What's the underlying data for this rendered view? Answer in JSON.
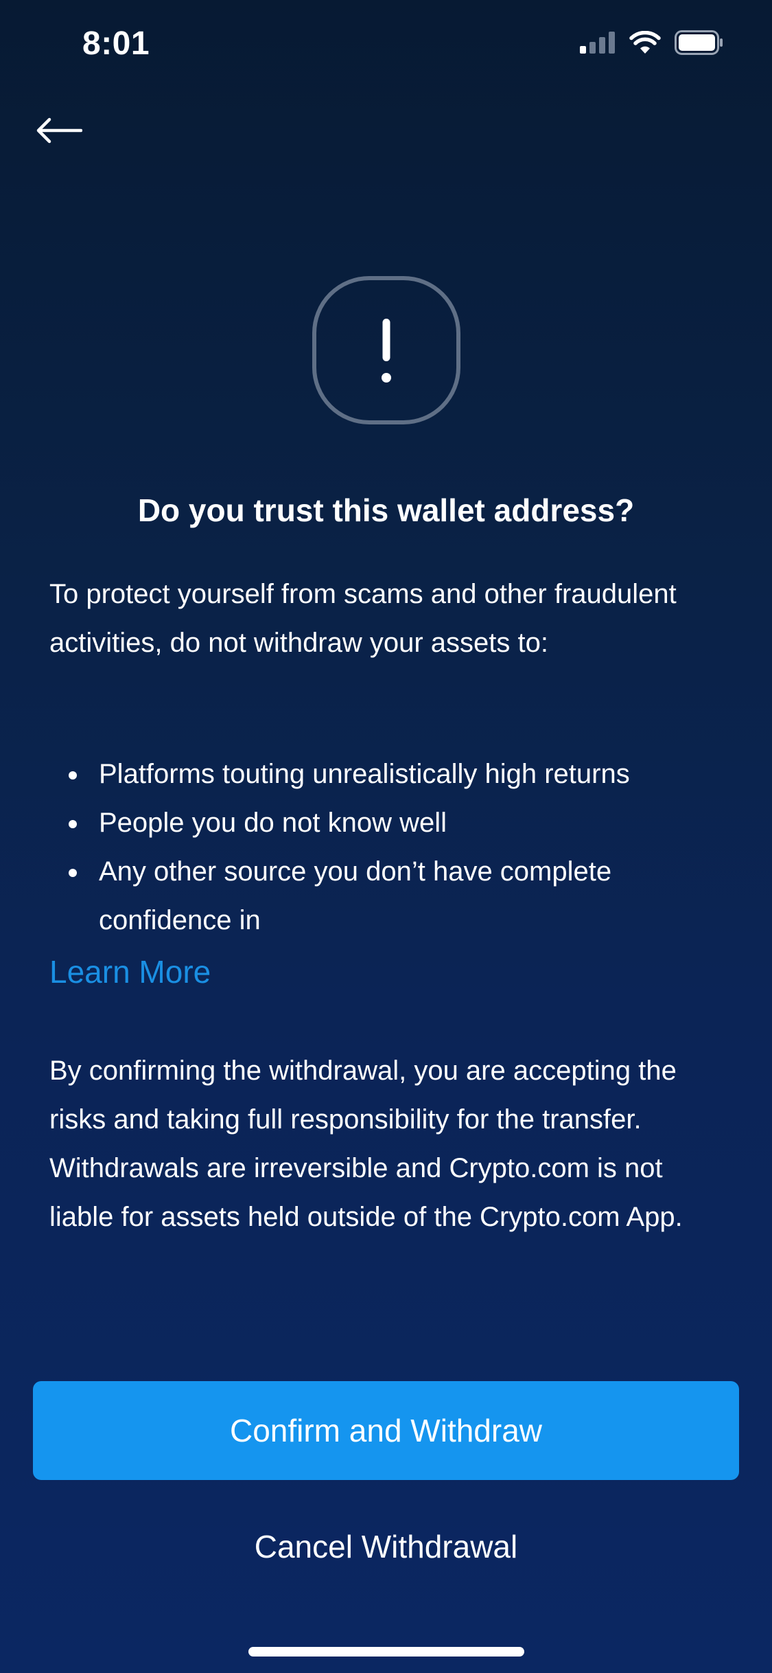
{
  "status_bar": {
    "time": "8:01",
    "icons": [
      "signal-icon",
      "wifi-icon",
      "battery-icon"
    ]
  },
  "navigation": {
    "back_icon": "back-arrow-icon"
  },
  "warning": {
    "icon": "exclamation-warning-icon",
    "title": "Do you trust this wallet address?",
    "intro": "To protect yourself from scams and other fraudulent activities, do not withdraw your assets to:",
    "bullets": [
      "Platforms touting unrealistically high returns",
      "People you do not know well",
      "Any other source you don’t have complete confidence in"
    ],
    "learn_more": "Learn More",
    "disclaimer": "By confirming the withdrawal, you are accepting the risks and taking full responsibility for the transfer. Withdrawals are irreversible and Crypto.com is not liable for assets held outside of the Crypto.com App."
  },
  "actions": {
    "confirm_label": "Confirm and Withdraw",
    "cancel_label": "Cancel Withdrawal"
  },
  "colors": {
    "background_top": "#071a33",
    "background_bottom": "#0b2762",
    "accent": "#1595ef",
    "link": "#1a8fe3"
  }
}
